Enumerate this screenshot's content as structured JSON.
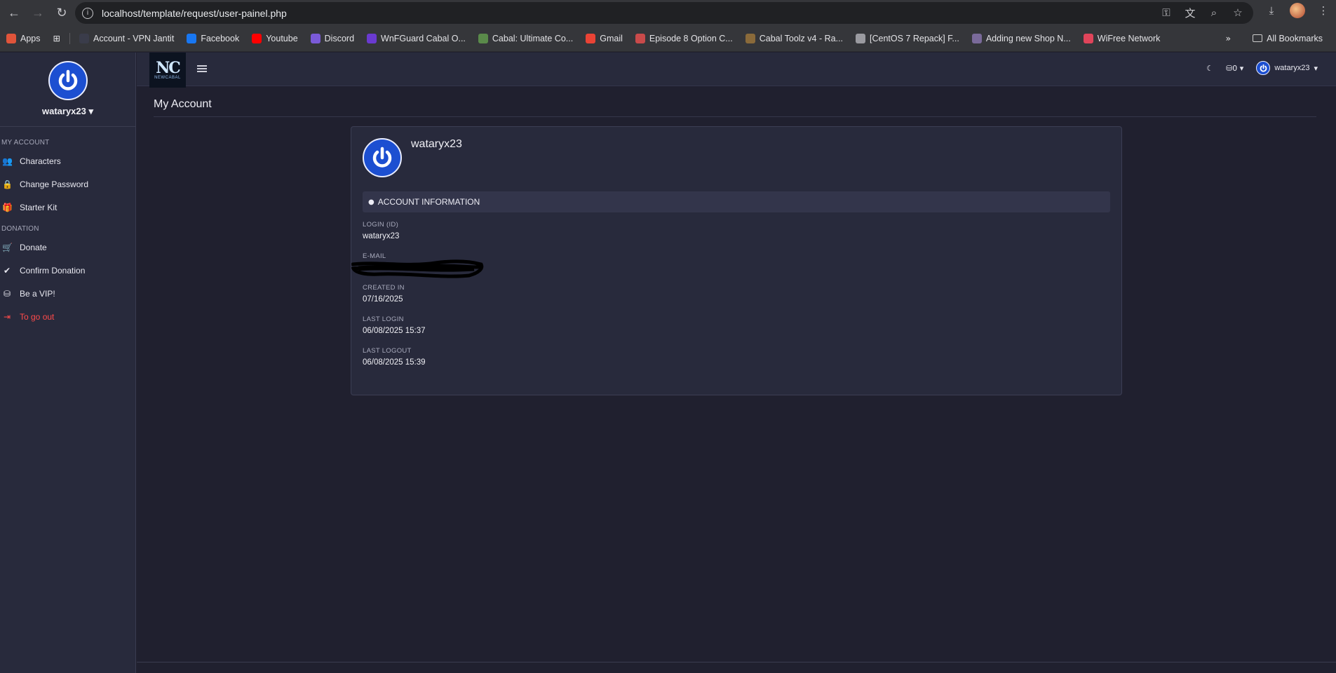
{
  "browser": {
    "url": "localhost/template/request/user-painel.php",
    "bookmarks": [
      {
        "label": "Apps",
        "color": "#e0543a"
      },
      {
        "label": "Account - VPN Jantit",
        "color": "#3a3c4a"
      },
      {
        "label": "Facebook",
        "color": "#1877f2"
      },
      {
        "label": "Youtube",
        "color": "#ff0000"
      },
      {
        "label": "Discord",
        "color": "#7a5ad8"
      },
      {
        "label": "WnFGuard Cabal O...",
        "color": "#6a3ad0"
      },
      {
        "label": "Cabal: Ultimate Co...",
        "color": "#5a8a4a"
      },
      {
        "label": "Gmail",
        "color": "#ea4335"
      },
      {
        "label": "Episode 8 Option C...",
        "color": "#c94a4a"
      },
      {
        "label": "Cabal Toolz v4 - Ra...",
        "color": "#8a6a3a"
      },
      {
        "label": "[CentOS 7 Repack] F...",
        "color": "#9a9aa0"
      },
      {
        "label": "Adding new Shop N...",
        "color": "#7a6a9a"
      },
      {
        "label": "WiFree Network",
        "color": "#e0445a"
      }
    ],
    "all_bookmarks": "All Bookmarks"
  },
  "sidebar": {
    "username": "wataryx23",
    "sections": [
      {
        "title": "MY ACCOUNT",
        "items": [
          {
            "label": "Characters",
            "icon": "users-icon",
            "glyph": "👥"
          },
          {
            "label": "Change Password",
            "icon": "lock-icon",
            "glyph": "🔒"
          },
          {
            "label": "Starter Kit",
            "icon": "gift-icon",
            "glyph": "🎁"
          }
        ]
      },
      {
        "title": "DONATION",
        "items": [
          {
            "label": "Donate",
            "icon": "cart-icon",
            "glyph": "🛒"
          },
          {
            "label": "Confirm Donation",
            "icon": "check-circle-icon",
            "glyph": "✔"
          },
          {
            "label": "Be a VIP!",
            "icon": "coins-icon",
            "glyph": "⛁"
          },
          {
            "label": "To go out",
            "icon": "sign-out-icon",
            "glyph": "⇥"
          }
        ]
      }
    ]
  },
  "topbar": {
    "brand_text": "NC",
    "brand_sub": "NEWCABAL",
    "coins": "0",
    "username": "wataryx23"
  },
  "page": {
    "title": "My Account",
    "card_name": "wataryx23",
    "section_title": "ACCOUNT INFORMATION",
    "fields": [
      {
        "label": "LOGIN (ID)",
        "value": "wataryx23"
      },
      {
        "label": "E-MAIL",
        "value": ""
      },
      {
        "label": "CREATED IN",
        "value": "07/16/2025"
      },
      {
        "label": "LAST LOGIN",
        "value": "06/08/2025 15:37"
      },
      {
        "label": "LAST LOGOUT",
        "value": "06/08/2025 15:39"
      }
    ]
  }
}
